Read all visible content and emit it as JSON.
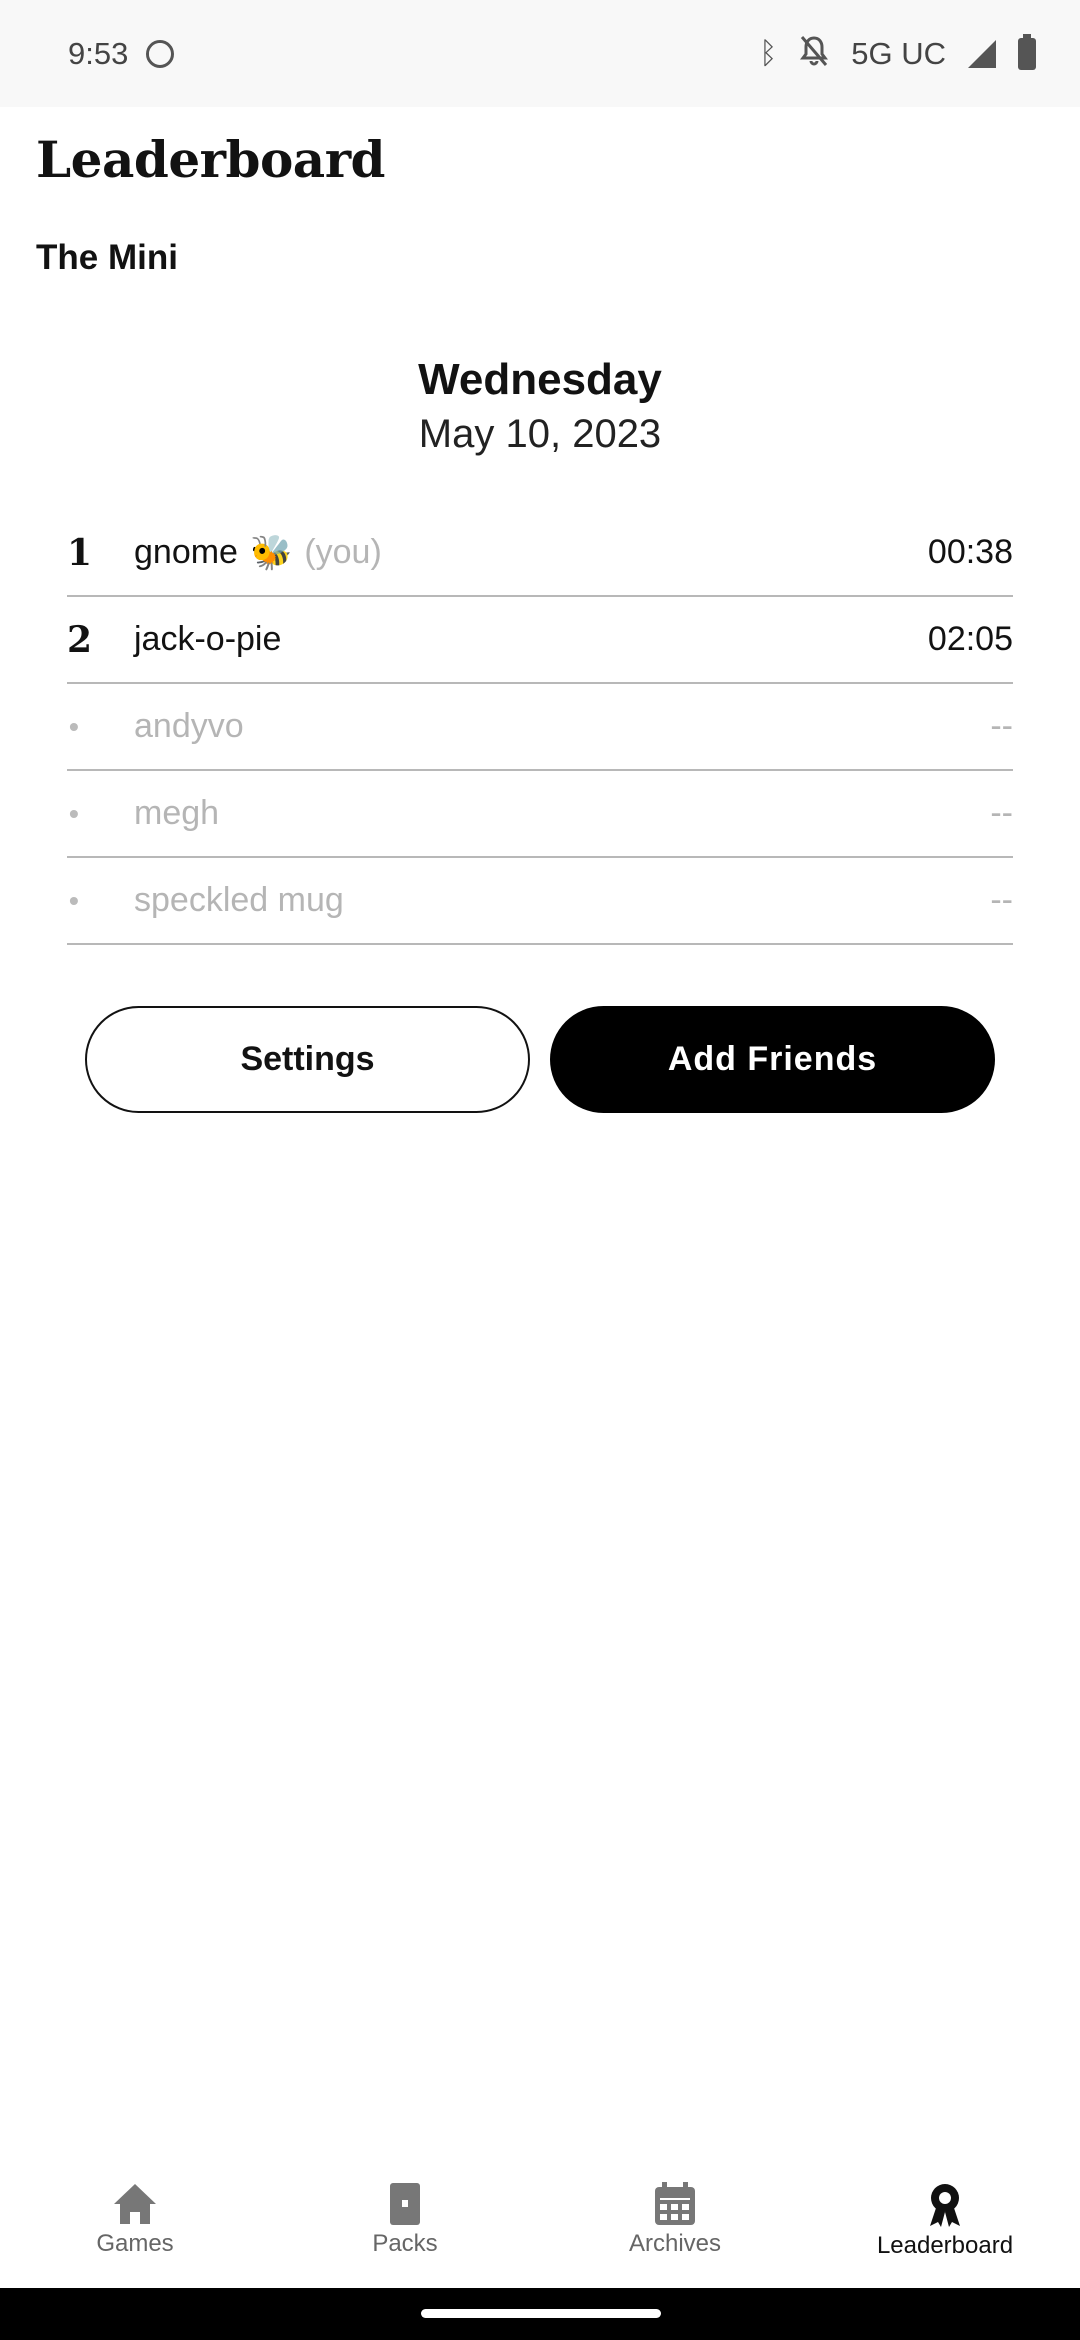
{
  "status_bar": {
    "time": "9:53",
    "network": "5G UC",
    "icons": [
      "moon-icon",
      "bluetooth-icon",
      "bell-off-icon",
      "signal-icon",
      "battery-icon"
    ]
  },
  "header": {
    "title": "Leaderboard",
    "section": "The Mini"
  },
  "date": {
    "day": "Wednesday",
    "full": "May 10, 2023"
  },
  "leaderboard": [
    {
      "rank": "1",
      "name": "gnome",
      "badge": "🐝",
      "you_label": "(you)",
      "time": "00:38"
    },
    {
      "rank": "2",
      "name": "jack-o-pie",
      "time": "02:05"
    },
    {
      "rank": "•",
      "name": "andyvo",
      "time": "--"
    },
    {
      "rank": "•",
      "name": "megh",
      "time": "--"
    },
    {
      "rank": "•",
      "name": "speckled mug",
      "time": "--"
    }
  ],
  "buttons": {
    "settings": "Settings",
    "add_friends": "Add Friends"
  },
  "nav": {
    "items": [
      {
        "label": "Games",
        "icon": "home-icon"
      },
      {
        "label": "Packs",
        "icon": "packs-icon"
      },
      {
        "label": "Archives",
        "icon": "calendar-icon"
      },
      {
        "label": "Leaderboard",
        "icon": "ribbon-icon"
      }
    ],
    "active": "Leaderboard"
  }
}
